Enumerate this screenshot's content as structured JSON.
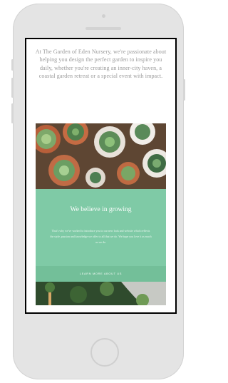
{
  "intro_text": "At The Garden of Eden Nursery, we're passionate about helping you design the perfect garden to inspire you daily, whether you're creating an inner-city haven, a coastal garden retreat or a special event with impact.",
  "belief_section": {
    "heading": "We believe in growing",
    "body": "That's why we've worked to introduce you to our new look and website which reflects the style, passion and knowledge we offer to all that we do. We hope you love it as much as we do.",
    "cta_label": "LEARN MORE ABOUT US"
  },
  "colors": {
    "panel_green": "#7fcaa6",
    "cta_green": "#73bf99",
    "intro_text": "#9a9a9a",
    "phone_body": "#e4e4e4"
  }
}
